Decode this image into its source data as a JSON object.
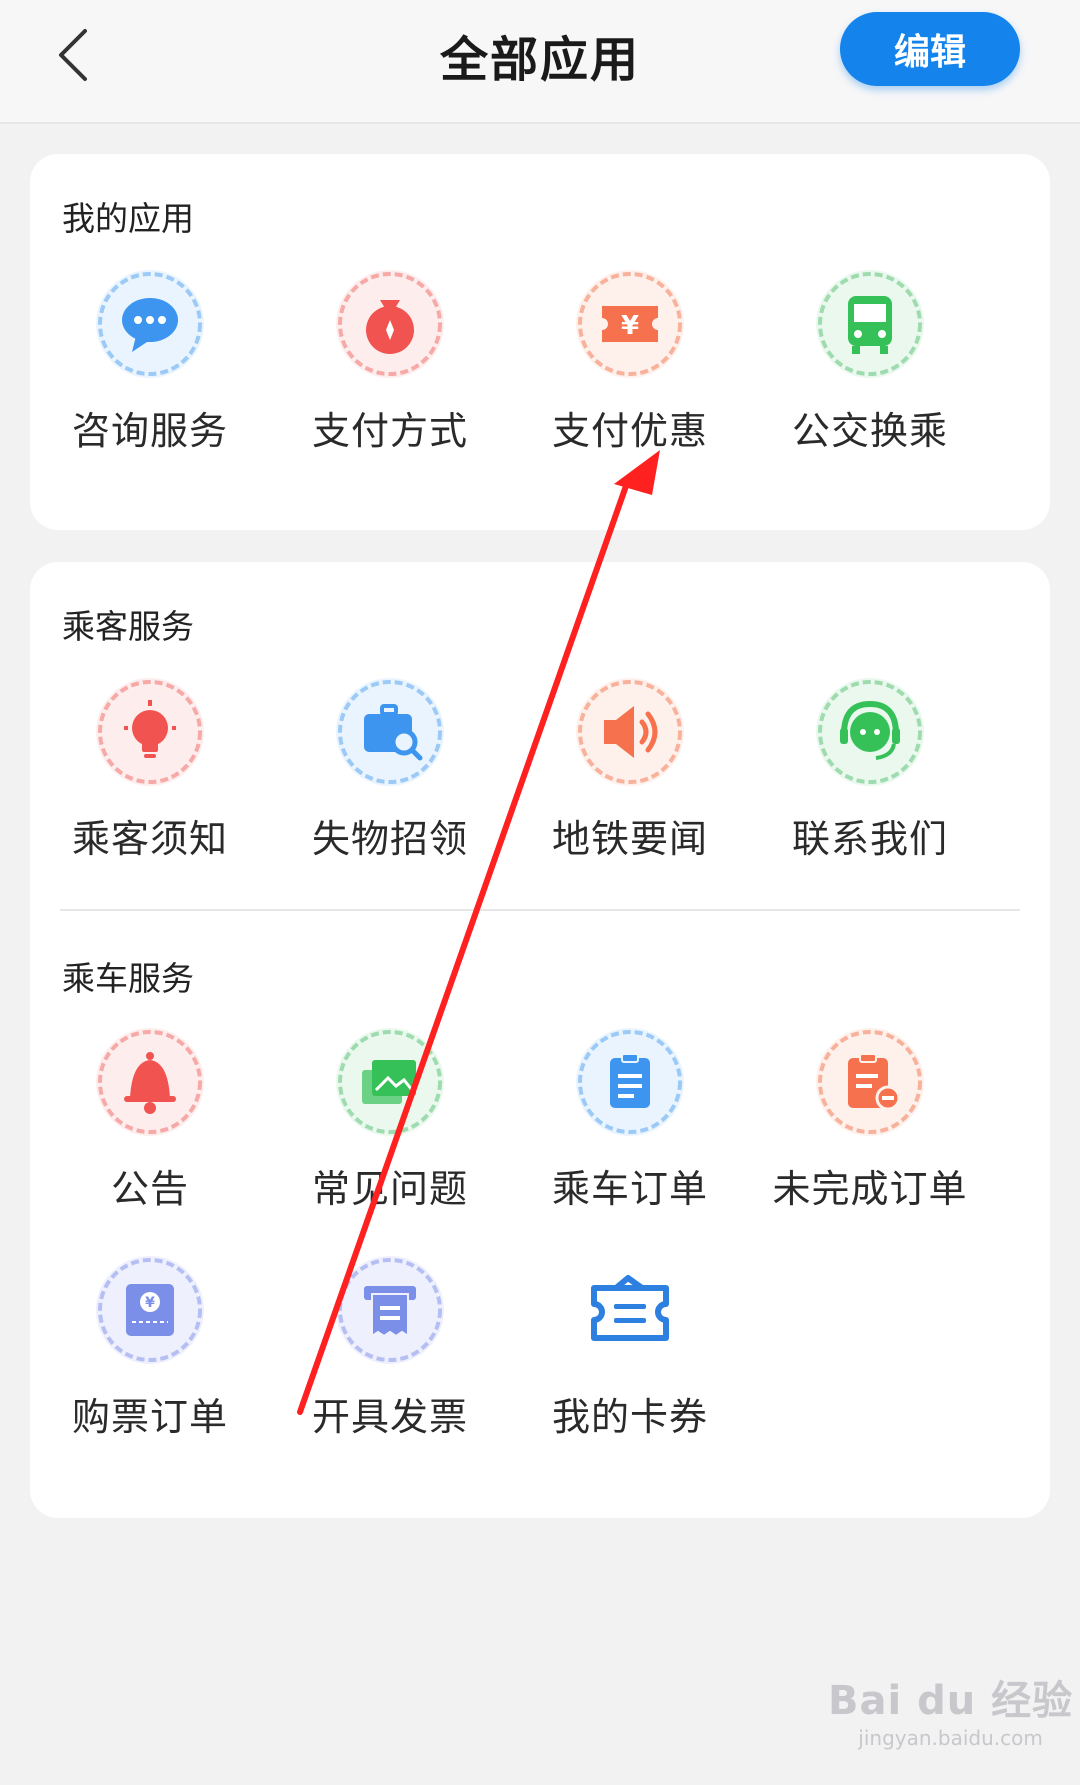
{
  "header": {
    "title": "全部应用",
    "edit_label": "编辑"
  },
  "my_apps": {
    "title": "我的应用",
    "items": [
      {
        "label": "咨询服务",
        "icon": "chat-bubble-icon"
      },
      {
        "label": "支付方式",
        "icon": "money-bag-icon"
      },
      {
        "label": "支付优惠",
        "icon": "yen-coupon-icon"
      },
      {
        "label": "公交换乘",
        "icon": "bus-icon"
      }
    ]
  },
  "passenger_services": {
    "title": "乘客服务",
    "items": [
      {
        "label": "乘客须知",
        "icon": "lightbulb-icon"
      },
      {
        "label": "失物招领",
        "icon": "briefcase-search-icon"
      },
      {
        "label": "地铁要闻",
        "icon": "speaker-icon"
      },
      {
        "label": "联系我们",
        "icon": "headset-agent-icon"
      }
    ]
  },
  "ride_services": {
    "title": "乘车服务",
    "items": [
      {
        "label": "公告",
        "icon": "bell-icon"
      },
      {
        "label": "常见问题",
        "icon": "photos-icon"
      },
      {
        "label": "乘车订单",
        "icon": "clipboard-icon"
      },
      {
        "label": "未完成订单",
        "icon": "clipboard-minus-icon"
      },
      {
        "label": "购票订单",
        "icon": "ticket-yen-icon"
      },
      {
        "label": "开具发票",
        "icon": "receipt-printer-icon"
      },
      {
        "label": "我的卡券",
        "icon": "card-ticket-icon"
      }
    ]
  },
  "watermark": {
    "brand": "Bai du 经验",
    "url": "jingyan.baidu.com"
  },
  "colors": {
    "accent": "#1583ec",
    "blue": "#3d95f0",
    "red": "#f15350",
    "orange": "#f6714d",
    "green": "#35c158",
    "purple": "#7b8ee8",
    "annotation": "#ff2020"
  }
}
